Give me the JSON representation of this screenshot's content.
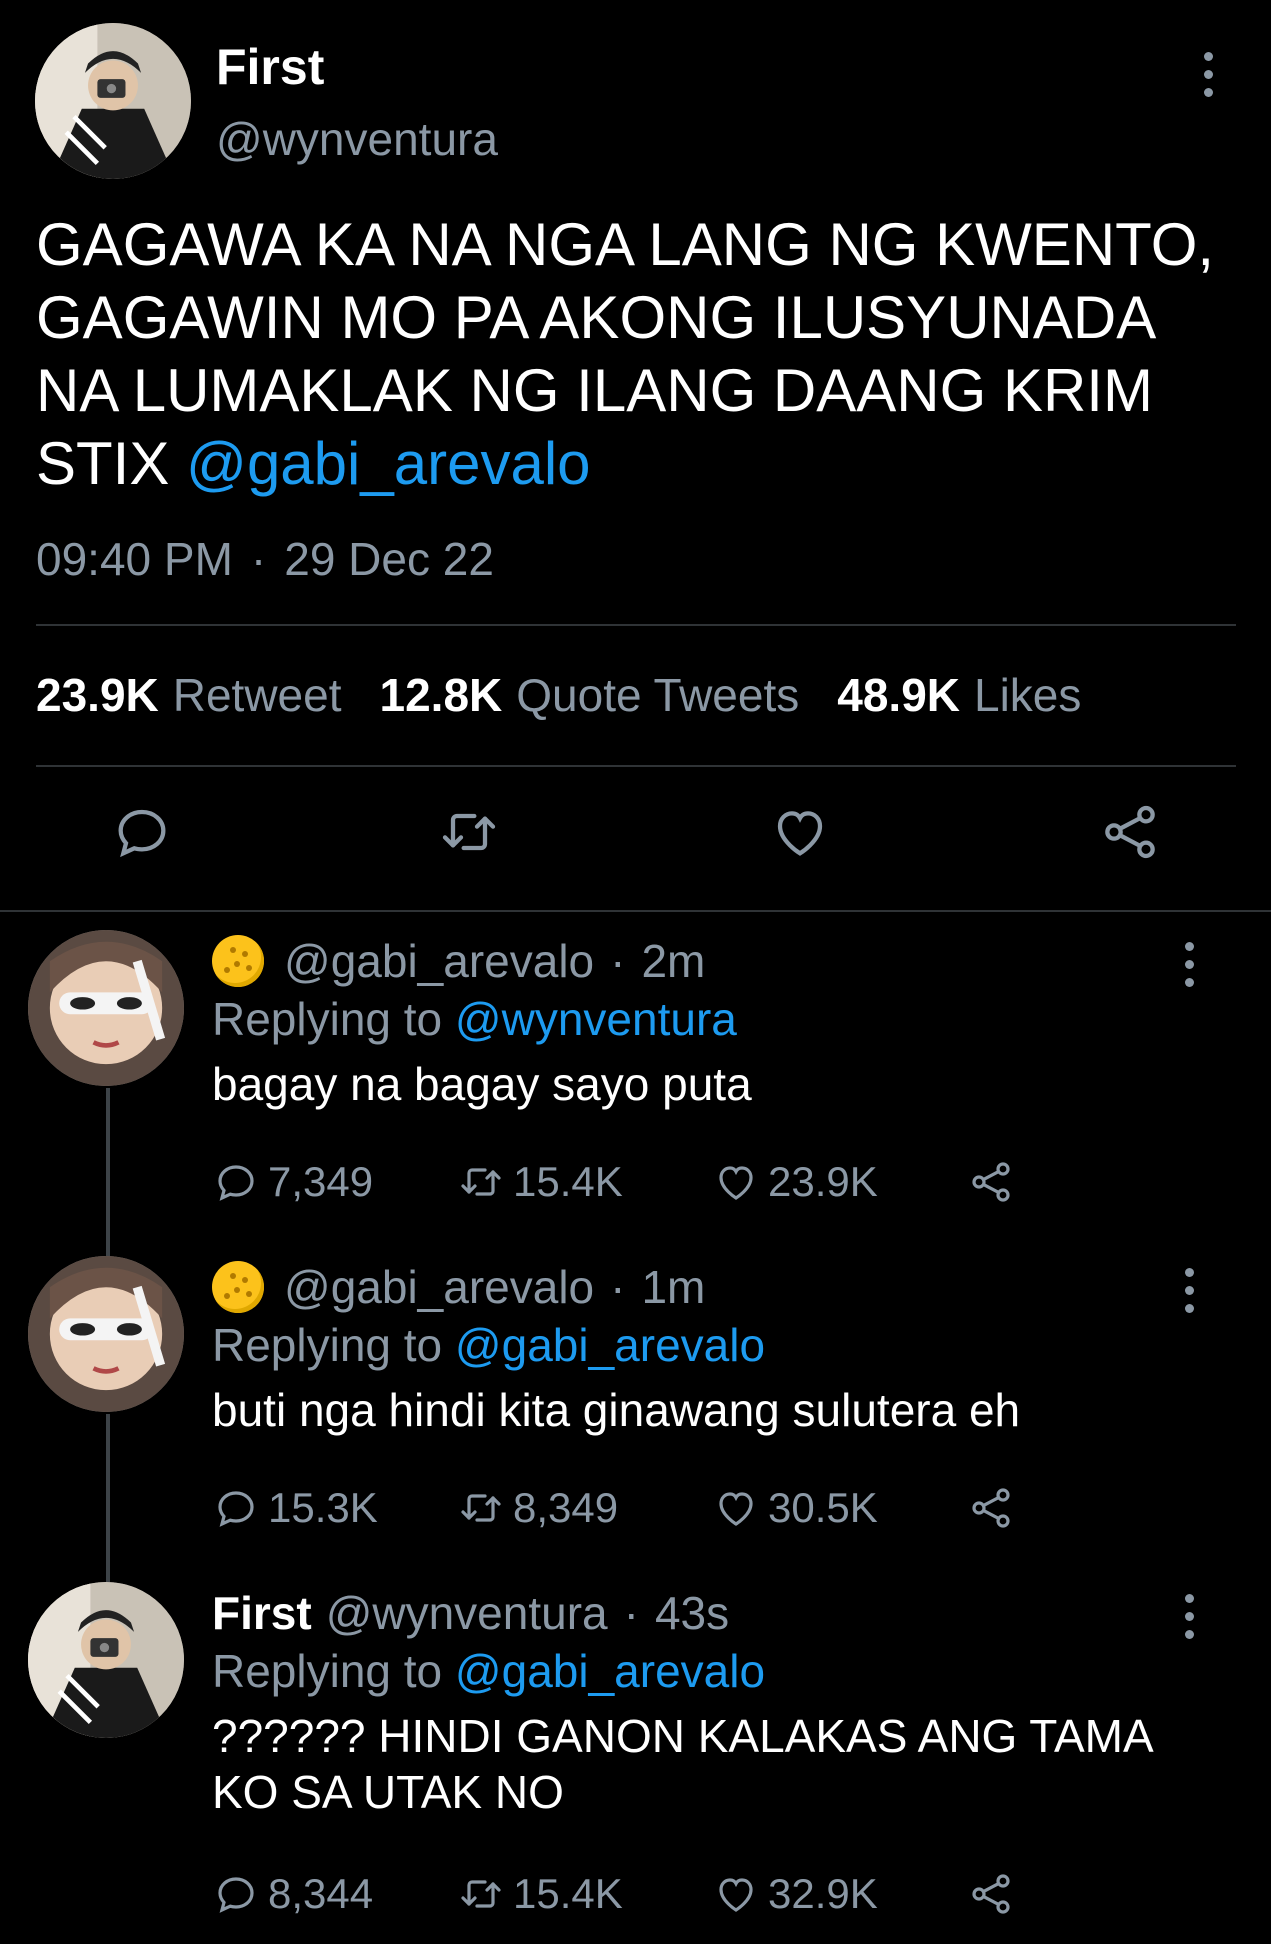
{
  "main_tweet": {
    "display_name": "First",
    "handle": "@wynventura",
    "text": "GAGAWA KA NA NGA LANG NG KWENTO, GAGAWIN MO PA AKONG ILUSYUNADA NA LUMAKLAK NG ILANG DAANG KRIM STIX",
    "mention": "@gabi_arevalo",
    "time": "09:40 PM",
    "separator": "·",
    "date": "29 Dec 22",
    "stats": {
      "retweets_count": "23.9K",
      "retweets_label": "Retweet",
      "quotes_count": "12.8K",
      "quotes_label": "Quote Tweets",
      "likes_count": "48.9K",
      "likes_label": "Likes"
    }
  },
  "replies": [
    {
      "name": "",
      "handle": "@gabi_arevalo",
      "separator": "·",
      "time": "2m",
      "replying_prefix": "Replying to",
      "replying_to": "@wynventura",
      "text": "bagay na bagay sayo puta",
      "replies_count": "7,349",
      "retweets_count": "15.4K",
      "likes_count": "23.9K"
    },
    {
      "name": "",
      "handle": "@gabi_arevalo",
      "separator": "·",
      "time": "1m",
      "replying_prefix": "Replying to",
      "replying_to": "@gabi_arevalo",
      "text": "buti nga hindi kita ginawang sulutera eh",
      "replies_count": "15.3K",
      "retweets_count": "8,349",
      "likes_count": "30.5K"
    },
    {
      "name": "First",
      "handle": "@wynventura",
      "separator": "·",
      "time": "43s",
      "replying_prefix": "Replying to",
      "replying_to": "@gabi_arevalo",
      "text": "?????? HINDI GANON KALAKAS ANG TAMA KO SA UTAK NO",
      "replies_count": "8,344",
      "retweets_count": "15.4K",
      "likes_count": "32.9K"
    }
  ],
  "colors": {
    "background": "#000000",
    "text": "#ffffff",
    "muted": "#8b98a5",
    "accent": "#1d9bf0",
    "divider": "#2f3336"
  },
  "icons": [
    "reply-icon",
    "retweet-icon",
    "like-icon",
    "share-icon",
    "more-icon",
    "emoji-moon-icon"
  ]
}
